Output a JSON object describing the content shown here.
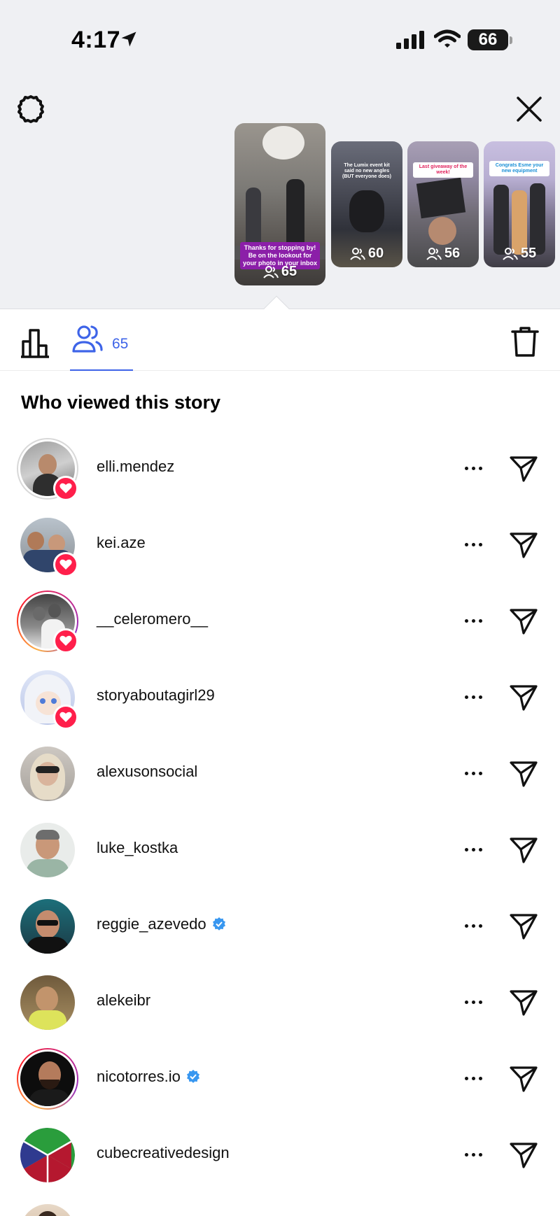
{
  "status_bar": {
    "time": "4:17",
    "battery": "66"
  },
  "stories": [
    {
      "count": "65",
      "caption": "Thanks for stopping by! Be on the lookout for your photo in your inbox"
    },
    {
      "count": "60",
      "caption": "The Lumix event kit said no new angles (BUT everyone does)"
    },
    {
      "count": "56",
      "caption": "Last giveaway of the week!"
    },
    {
      "count": "55",
      "caption": "Congrats Esme your new equipment"
    }
  ],
  "tabs": {
    "viewers_count": "65"
  },
  "section_title": "Who viewed this story",
  "viewers": [
    {
      "username": "elli.mendez",
      "liked": true,
      "verified": false,
      "ring": "grey"
    },
    {
      "username": "kei.aze",
      "liked": true,
      "verified": false,
      "ring": "none"
    },
    {
      "username": "__celeromero__",
      "liked": true,
      "verified": false,
      "ring": "story"
    },
    {
      "username": "storyaboutagirl29",
      "liked": true,
      "verified": false,
      "ring": "none"
    },
    {
      "username": "alexusonsocial",
      "liked": false,
      "verified": false,
      "ring": "none"
    },
    {
      "username": "luke_kostka",
      "liked": false,
      "verified": false,
      "ring": "none"
    },
    {
      "username": "reggie_azevedo",
      "liked": false,
      "verified": true,
      "ring": "none"
    },
    {
      "username": "alekeibr",
      "liked": false,
      "verified": false,
      "ring": "none"
    },
    {
      "username": "nicotorres.io",
      "liked": false,
      "verified": true,
      "ring": "story"
    },
    {
      "username": "cubecreativedesign",
      "liked": false,
      "verified": false,
      "ring": "none"
    }
  ],
  "colors": {
    "accent": "#3e64e8",
    "like": "#ff1f4b",
    "verified": "#3897f0"
  }
}
